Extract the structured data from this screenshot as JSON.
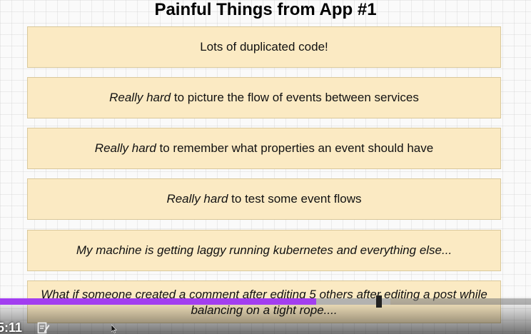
{
  "slide": {
    "title": "Painful Things from App #1",
    "cards": [
      {
        "text": "Lots of duplicated code!"
      },
      {
        "emph": "Really hard",
        "rest": " to picture the flow of events between services"
      },
      {
        "emph": "Really hard",
        "rest": " to remember what properties an event should have"
      },
      {
        "emph": "Really hard",
        "rest": " to test some event flows"
      },
      {
        "text": "My machine is getting laggy running kubernetes and everything else..."
      },
      {
        "text": "What if someone created a comment after editing 5 others after editing a post while balancing on a tight rope...."
      }
    ]
  },
  "player": {
    "current_time": "5:11",
    "progress_fraction": 0.595,
    "buffered_fraction": 0.735,
    "notes_icon": "notes-icon",
    "colors": {
      "played": "#a23ef0",
      "card_bg": "#fbeac3"
    }
  }
}
